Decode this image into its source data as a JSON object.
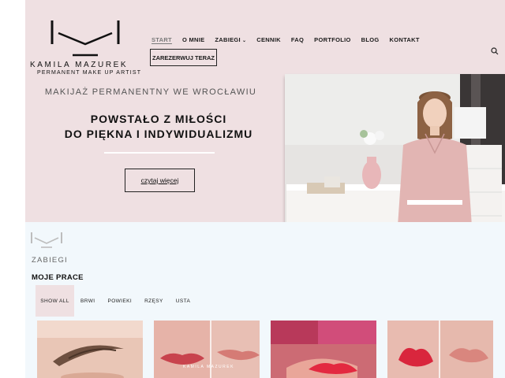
{
  "brand": {
    "name": "KAMILA MAZUREK",
    "tagline": "PERMANENT MAKE UP ARTIST"
  },
  "nav": {
    "items": [
      {
        "label": "START",
        "active": true
      },
      {
        "label": "O MNIE"
      },
      {
        "label": "ZABIEGI",
        "has_dropdown": true
      },
      {
        "label": "CENNIK"
      },
      {
        "label": "FAQ"
      },
      {
        "label": "PORTFOLIO"
      },
      {
        "label": "BLOG"
      },
      {
        "label": "KONTAKT"
      }
    ],
    "book_button": "ZAREZERWUJ TERAZ",
    "search_icon": "search-icon"
  },
  "hero": {
    "subtitle": "MAKIJAŻ PERMANENTNY WE WROCŁAWIU",
    "headline_line1": "POWSTAŁO Z MIŁOŚCI",
    "headline_line2": "DO PIĘKNA I INDYWIDUALIZMU",
    "more_button": "czytaj więcej",
    "photo_icon": "artist-portrait-photo"
  },
  "works": {
    "label": "ZABIEGI",
    "title": "MOJE PRACE",
    "filters": [
      {
        "label": "SHOW ALL",
        "active": true
      },
      {
        "label": "BRWI"
      },
      {
        "label": "POWIEKI"
      },
      {
        "label": "RZĘSY"
      },
      {
        "label": "USTA"
      }
    ],
    "thumbnails": [
      {
        "icon": "eyebrow-photo"
      },
      {
        "icon": "lips-before-after-photo"
      },
      {
        "icon": "lips-photo"
      },
      {
        "icon": "lips-before-after-photo"
      }
    ]
  },
  "colors": {
    "hero_bg": "#efe0e2",
    "lower_bg": "#f2f8fc",
    "text": "#1a1a1a"
  }
}
